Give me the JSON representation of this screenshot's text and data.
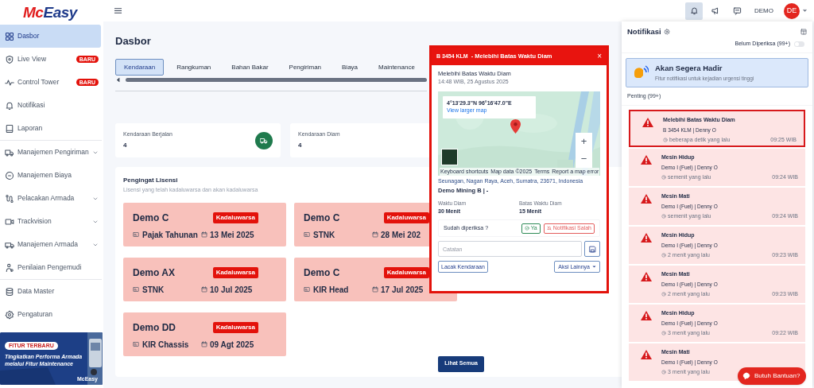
{
  "logo": {
    "part_1": "Mc",
    "part_2": "Easy"
  },
  "sidebar": {
    "sections": [
      {
        "items": [
          {
            "label": "Dasbor",
            "kind": "link",
            "selected": true
          },
          {
            "label": "Live View",
            "kind": "link",
            "selected": false,
            "badge": "BARU"
          },
          {
            "label": "Control Tower",
            "kind": "link",
            "selected": false,
            "badge": "BARU"
          },
          {
            "label": "Notifikasi",
            "kind": "link",
            "selected": false
          },
          {
            "label": "Laporan",
            "kind": "link",
            "selected": false
          }
        ]
      },
      {
        "items": [
          {
            "label": "Manajemen Pengiriman",
            "kind": "group",
            "selected": false
          },
          {
            "label": "Manajemen Biaya",
            "kind": "link",
            "selected": false
          },
          {
            "label": "Pelacakan Armada",
            "kind": "group",
            "selected": false
          },
          {
            "label": "Trackvision",
            "kind": "group",
            "selected": false
          },
          {
            "label": "Manajemen Armada",
            "kind": "group",
            "selected": false
          },
          {
            "label": "Penilaian Pengemudi",
            "kind": "link",
            "selected": false
          }
        ]
      },
      {
        "items": [
          {
            "label": "Data Master",
            "kind": "link",
            "selected": false
          },
          {
            "label": "Pengaturan",
            "kind": "link",
            "selected": false
          }
        ]
      }
    ],
    "banner": {
      "tag": "FITUR TERBARU",
      "text": "Tingkatkan Performa Armada melalui Fitur Maintenance",
      "brand": "McEasy"
    }
  },
  "topbar": {
    "buttons": [
      {
        "selected": true
      },
      {
        "selected": false
      },
      {
        "selected": false
      }
    ],
    "user": "DEMO",
    "avatar": "DE"
  },
  "page": {
    "title": "Dasbor",
    "tabs": [
      {
        "label": "Kendaraan",
        "selected": true
      },
      {
        "label": "Rangkuman",
        "selected": false
      },
      {
        "label": "Bahan Bakar",
        "selected": false
      },
      {
        "label": "Pengiriman",
        "selected": false
      },
      {
        "label": "Biaya",
        "selected": false
      },
      {
        "label": "Maintenance",
        "selected": false
      }
    ],
    "stats": [
      {
        "label": "Kendaraan Berjalan",
        "value": "4"
      },
      {
        "label": "Kendaraan Diam",
        "value": "4"
      }
    ],
    "licenses": {
      "title": "Pengingat Lisensi",
      "subtitle": "Lisensi yang telah kadaluwarsa dan akan kadaluwarsa",
      "cards": [
        {
          "name": "Demo C",
          "status": "Kadaluwarsa",
          "document": "Pajak Tahunan",
          "date": "13 Mei 2025"
        },
        {
          "name": "Demo C",
          "status": "Kadaluwarsa",
          "document": "STNK",
          "date": "28 Mei 202"
        },
        {
          "name": "Demo AX",
          "status": "Kadaluwarsa",
          "document": "STNK",
          "date": "10 Jul 2025"
        },
        {
          "name": "Demo C",
          "status": "Kadaluwarsa",
          "document": "KIR Head",
          "date": "17 Jul 2025"
        },
        {
          "name": "Demo DD",
          "status": "Kadaluwarsa",
          "document": "KIR Chassis",
          "date": "09 Agt 2025"
        }
      ],
      "button": "Lihat Semua"
    }
  },
  "popup": {
    "plate": "B 3454 KLM",
    "title": "- Melebihi Batas Waktu Diam",
    "close": "×",
    "event": "Melebihi Batas Waktu Diam",
    "datetime": "14:48 WIB, 25 Agustus 2025",
    "map": {
      "coordinates": "4°13'29.3\"N 96°16'47.0\"E",
      "link": "View larger map",
      "zoom_in": "+",
      "zoom_out": "−",
      "attribution": [
        "Keyboard shortcuts",
        "Map data ©2025",
        "Terms",
        "Report a map error"
      ]
    },
    "address": "Seunagan, Nagan Raya, Aceh, Sumatra, 23671, Indonesia",
    "site": "Demo Mining B | -",
    "fields": [
      {
        "label": "Waktu Diam",
        "value": "30 Menit"
      },
      {
        "label": "Batas Waktu Diam",
        "value": "15 Menit"
      }
    ],
    "question": "Sudah diperiksa ?",
    "yes": "Ya",
    "wrong": "Notifikasi Salah",
    "note_placeholder": "Catatan",
    "track": "Lacak Kendaraan",
    "more": "Aksi Lainnya"
  },
  "notifications": {
    "title": "Notifikasi",
    "filter": "Belum Diperiksa (99+)",
    "filter_on": false,
    "banner": {
      "title": "Akan Segera Hadir",
      "text": "Fitur notifikasi untuk kejadian urgensi tinggi"
    },
    "section": "Penting (99+)",
    "items": [
      {
        "title": "Melebihi Batas Waktu Diam",
        "subtitle": "B 3454 KLM | Denny O",
        "ago": "beberapa detik yang lalu",
        "time": "09:25 WIB",
        "selected": true
      },
      {
        "title": "Mesin Hidup",
        "subtitle": "Demo I (Fuel) | Denny O",
        "ago": "semenit yang lalu",
        "time": "09:24 WIB",
        "selected": false
      },
      {
        "title": "Mesin Mati",
        "subtitle": "Demo I (Fuel) | Denny O",
        "ago": "semenit yang lalu",
        "time": "09:24 WIB",
        "selected": false
      },
      {
        "title": "Mesin Hidup",
        "subtitle": "Demo I (Fuel) | Denny O",
        "ago": "2 menit yang lalu",
        "time": "09:23 WIB",
        "selected": false
      },
      {
        "title": "Mesin Mati",
        "subtitle": "Demo I (Fuel) | Denny O",
        "ago": "2 menit yang lalu",
        "time": "09:23 WIB",
        "selected": false
      },
      {
        "title": "Mesin Hidup",
        "subtitle": "Demo I (Fuel) | Denny O",
        "ago": "3 menit yang lalu",
        "time": "09:22 WIB",
        "selected": false
      },
      {
        "title": "Mesin Mati",
        "subtitle": "Demo I (Fuel) | Denny O",
        "ago": "3 menit yang lalu",
        "selected": false
      }
    ]
  },
  "help_button": "Butuh Bantuan?"
}
